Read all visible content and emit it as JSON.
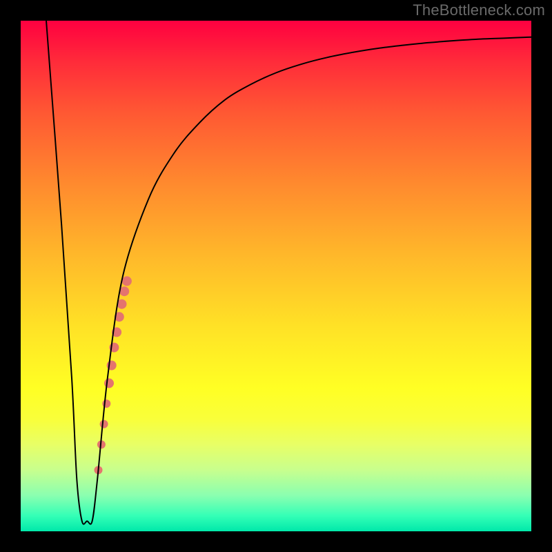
{
  "watermark": "TheBottleneck.com",
  "chart_data": {
    "type": "line",
    "title": "",
    "xlabel": "",
    "ylabel": "",
    "xlim": [
      0,
      100
    ],
    "ylim": [
      0,
      100
    ],
    "series": [
      {
        "name": "bottleneck-curve",
        "x": [
          5,
          8,
          10,
          11,
          12,
          13,
          14,
          15,
          17,
          20,
          25,
          30,
          35,
          40,
          45,
          50,
          55,
          60,
          65,
          70,
          75,
          80,
          85,
          90,
          95,
          100
        ],
        "y": [
          100,
          60,
          30,
          10,
          2,
          2,
          2,
          10,
          30,
          50,
          65,
          74,
          80,
          84.5,
          87.5,
          89.8,
          91.5,
          92.8,
          93.8,
          94.6,
          95.2,
          95.7,
          96.1,
          96.4,
          96.6,
          96.8
        ]
      }
    ],
    "highlight_points": {
      "name": "highlight-segment",
      "color": "#e4746e",
      "points": [
        {
          "x": 15.2,
          "y": 12,
          "r": 6
        },
        {
          "x": 15.8,
          "y": 17,
          "r": 6
        },
        {
          "x": 16.3,
          "y": 21,
          "r": 6
        },
        {
          "x": 16.8,
          "y": 25,
          "r": 6
        },
        {
          "x": 17.3,
          "y": 29,
          "r": 7
        },
        {
          "x": 17.8,
          "y": 32.5,
          "r": 7
        },
        {
          "x": 18.3,
          "y": 36,
          "r": 7
        },
        {
          "x": 18.8,
          "y": 39,
          "r": 7
        },
        {
          "x": 19.3,
          "y": 42,
          "r": 7
        },
        {
          "x": 19.8,
          "y": 44.5,
          "r": 7
        },
        {
          "x": 20.3,
          "y": 47,
          "r": 7
        },
        {
          "x": 20.8,
          "y": 49,
          "r": 7
        }
      ]
    }
  }
}
